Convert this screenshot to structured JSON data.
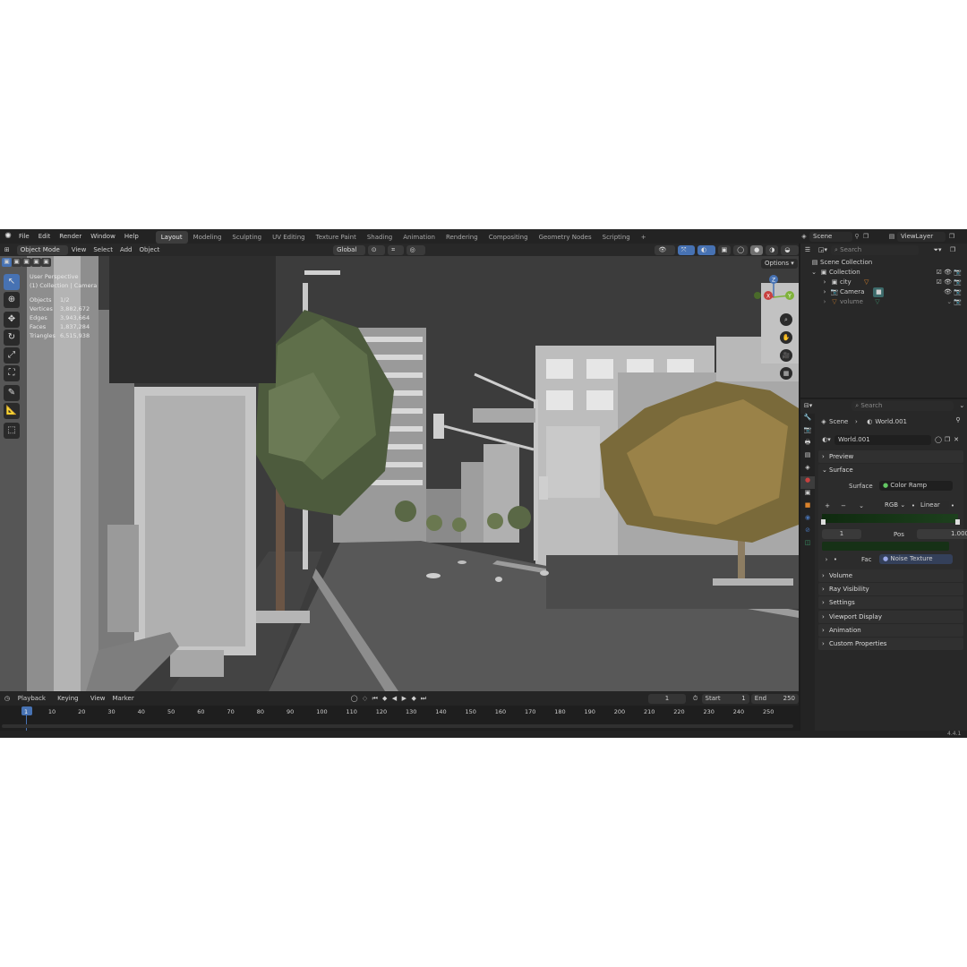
{
  "menu": {
    "items": [
      "File",
      "Edit",
      "Render",
      "Window",
      "Help"
    ],
    "workspaces": [
      "Layout",
      "Modeling",
      "Sculpting",
      "UV Editing",
      "Texture Paint",
      "Shading",
      "Animation",
      "Rendering",
      "Compositing",
      "Geometry Nodes",
      "Scripting"
    ],
    "active_workspace": "Layout",
    "add_tab": "+",
    "scene_label": "Scene",
    "viewlayer_label": "ViewLayer"
  },
  "viewport_header": {
    "mode": "Object Mode",
    "menus": [
      "View",
      "Select",
      "Add",
      "Object"
    ],
    "orientation": "Global",
    "options": "Options"
  },
  "overlay": {
    "view_name": "User Perspective",
    "collection": "(1) Collection | Camera",
    "stats": [
      {
        "label": "Objects",
        "value": "1/2"
      },
      {
        "label": "Vertices",
        "value": "3,882,672"
      },
      {
        "label": "Edges",
        "value": "3,943,664"
      },
      {
        "label": "Faces",
        "value": "1,837,284"
      },
      {
        "label": "Triangles",
        "value": "6,515,938"
      }
    ]
  },
  "gizmo": {
    "z": "Z",
    "y": "Y",
    "x": "X"
  },
  "timeline": {
    "menus": [
      "Playback",
      "Keying",
      "View",
      "Marker"
    ],
    "current_frame": "1",
    "start_label": "Start",
    "start_value": "1",
    "end_label": "End",
    "end_value": "250",
    "ticks": [
      "1",
      "10",
      "20",
      "30",
      "40",
      "50",
      "60",
      "70",
      "80",
      "90",
      "100",
      "110",
      "120",
      "130",
      "140",
      "150",
      "160",
      "170",
      "180",
      "190",
      "200",
      "210",
      "220",
      "230",
      "240",
      "250"
    ]
  },
  "outliner": {
    "search_placeholder": "Search",
    "scene_collection": "Scene Collection",
    "items": [
      {
        "name": "Collection",
        "level": 1
      },
      {
        "name": "city",
        "level": 2
      },
      {
        "name": "Camera",
        "level": 2
      },
      {
        "name": "volume",
        "level": 2
      }
    ]
  },
  "properties": {
    "search_placeholder": "Search",
    "breadcrumb_scene": "Scene",
    "breadcrumb_world": "World.001",
    "world_name": "World.001",
    "sections": [
      "Preview",
      "Surface",
      "Volume",
      "Ray Visibility",
      "Settings",
      "Viewport Display",
      "Animation",
      "Custom Properties"
    ],
    "surface_label": "Surface",
    "surface_value": "Color Ramp",
    "color_mode": "RGB",
    "interpolation": "Linear",
    "stop_index": "1",
    "pos_label": "Pos",
    "pos_value": "1.000",
    "fac_label": "Fac",
    "fac_value": "Noise Texture"
  },
  "status_bar": {
    "version": "4.4.1"
  }
}
